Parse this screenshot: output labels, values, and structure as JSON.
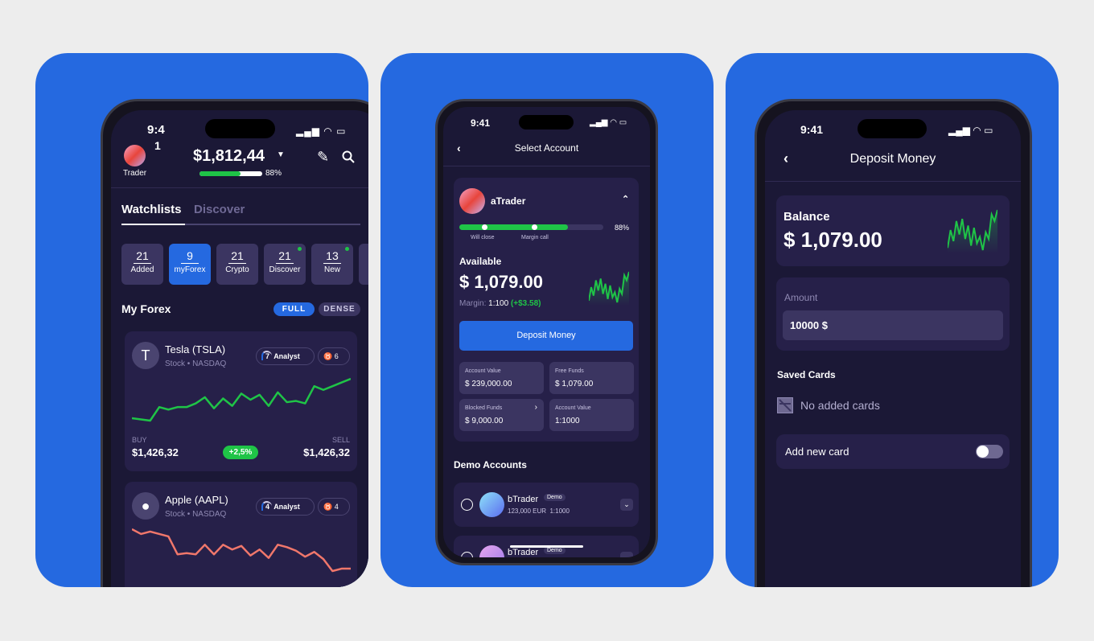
{
  "colors": {
    "accent": "#2569e0",
    "positive": "#1fc447",
    "negative": "#f0776b",
    "screen_bg": "#1b1836"
  },
  "watchlist_screen": {
    "status_time": "9:4",
    "status_time_wrap": "1",
    "avatar_label": "Trader",
    "balance": "$1,812,44",
    "margin_level_pct": 88,
    "margin_level_label": "88%",
    "tabs": [
      {
        "label": "Watchlists",
        "active": true
      },
      {
        "label": "Discover",
        "active": false
      }
    ],
    "lists": [
      {
        "count": "21",
        "label": "Added"
      },
      {
        "count": "9",
        "label": "myForex",
        "active": true
      },
      {
        "count": "21",
        "label": "Crypto"
      },
      {
        "count": "21",
        "label": "Discover",
        "dot": true
      },
      {
        "count": "13",
        "label": "New",
        "dot": true
      },
      {
        "count": "",
        "label": "C"
      }
    ],
    "section_title": "My Forex",
    "view_modes": [
      "FULL",
      "DENSE"
    ],
    "assets": [
      {
        "name": "Tesla (TSLA)",
        "type": "Stock",
        "exchange": "NASDAQ",
        "analyst_score": "7",
        "analyst_label": "Analyst",
        "bull_count": "6",
        "buy_label": "BUY",
        "buy": "$1,426,32",
        "change": "+2,5%",
        "sell_label": "SELL",
        "sell": "$1,426,32",
        "trend": "up",
        "sparkline": [
          3,
          2,
          1,
          12,
          10,
          12,
          12,
          15,
          20,
          11,
          19,
          13,
          23,
          18,
          22,
          13,
          24,
          16,
          17,
          15,
          29,
          26,
          29,
          32,
          35
        ]
      },
      {
        "name": "Apple (AAPL)",
        "type": "Stock",
        "exchange": "NASDAQ",
        "analyst_score": "4",
        "analyst_label": "Analyst",
        "bull_count": "4",
        "buy_label": "BUY",
        "sell_label": "SELL",
        "trend": "down",
        "sparkline": [
          35,
          31,
          33,
          31,
          29,
          14,
          15,
          14,
          22,
          14,
          22,
          18,
          21,
          13,
          18,
          11,
          22,
          20,
          17,
          12,
          16,
          10,
          0,
          2,
          2
        ]
      }
    ]
  },
  "select_account_screen": {
    "status_time": "9:41",
    "title": "Select Account",
    "account": {
      "name": "aTrader",
      "margin_level_pct": 88,
      "margin_level_label": "88%",
      "markers": [
        "Will close",
        "Margin call"
      ],
      "available_label": "Available",
      "available": "$ 1,079.00",
      "margin_label": "Margin:",
      "margin": "1:100",
      "margin_change": "(+$3.58)",
      "deposit_button": "Deposit Money",
      "stats": [
        {
          "label": "Account Value",
          "value": "$ 239,000.00"
        },
        {
          "label": "Free Funds",
          "value": "$ 1,079.00"
        },
        {
          "label": "Blocked Funds",
          "value": "$ 9,000.00",
          "has_chevron": true
        },
        {
          "label": "Account Value",
          "value": "1:1000"
        }
      ],
      "sparkline": [
        2,
        10,
        5,
        14,
        8,
        15,
        6,
        12,
        3,
        11,
        4,
        7,
        1,
        9,
        6,
        17,
        14,
        19
      ]
    },
    "demo_title": "Demo Accounts",
    "demo_accounts": [
      {
        "name": "bTrader",
        "badge": "Demo",
        "balance": "123,000 EUR",
        "leverage": "1:1000"
      },
      {
        "name": "bTrader",
        "badge": "Demo"
      }
    ]
  },
  "deposit_screen": {
    "status_time": "9:41",
    "title": "Deposit Money",
    "balance_label": "Balance",
    "balance": "$ 1,079.00",
    "amount_label": "Amount",
    "amount_value": "10000 $",
    "saved_cards_title": "Saved Cards",
    "no_cards": "No added cards",
    "add_card_label": "Add new card",
    "add_card_enabled": false,
    "sparkline": [
      2,
      10,
      5,
      14,
      8,
      15,
      6,
      12,
      3,
      11,
      4,
      7,
      1,
      9,
      6,
      17,
      14,
      19
    ]
  }
}
